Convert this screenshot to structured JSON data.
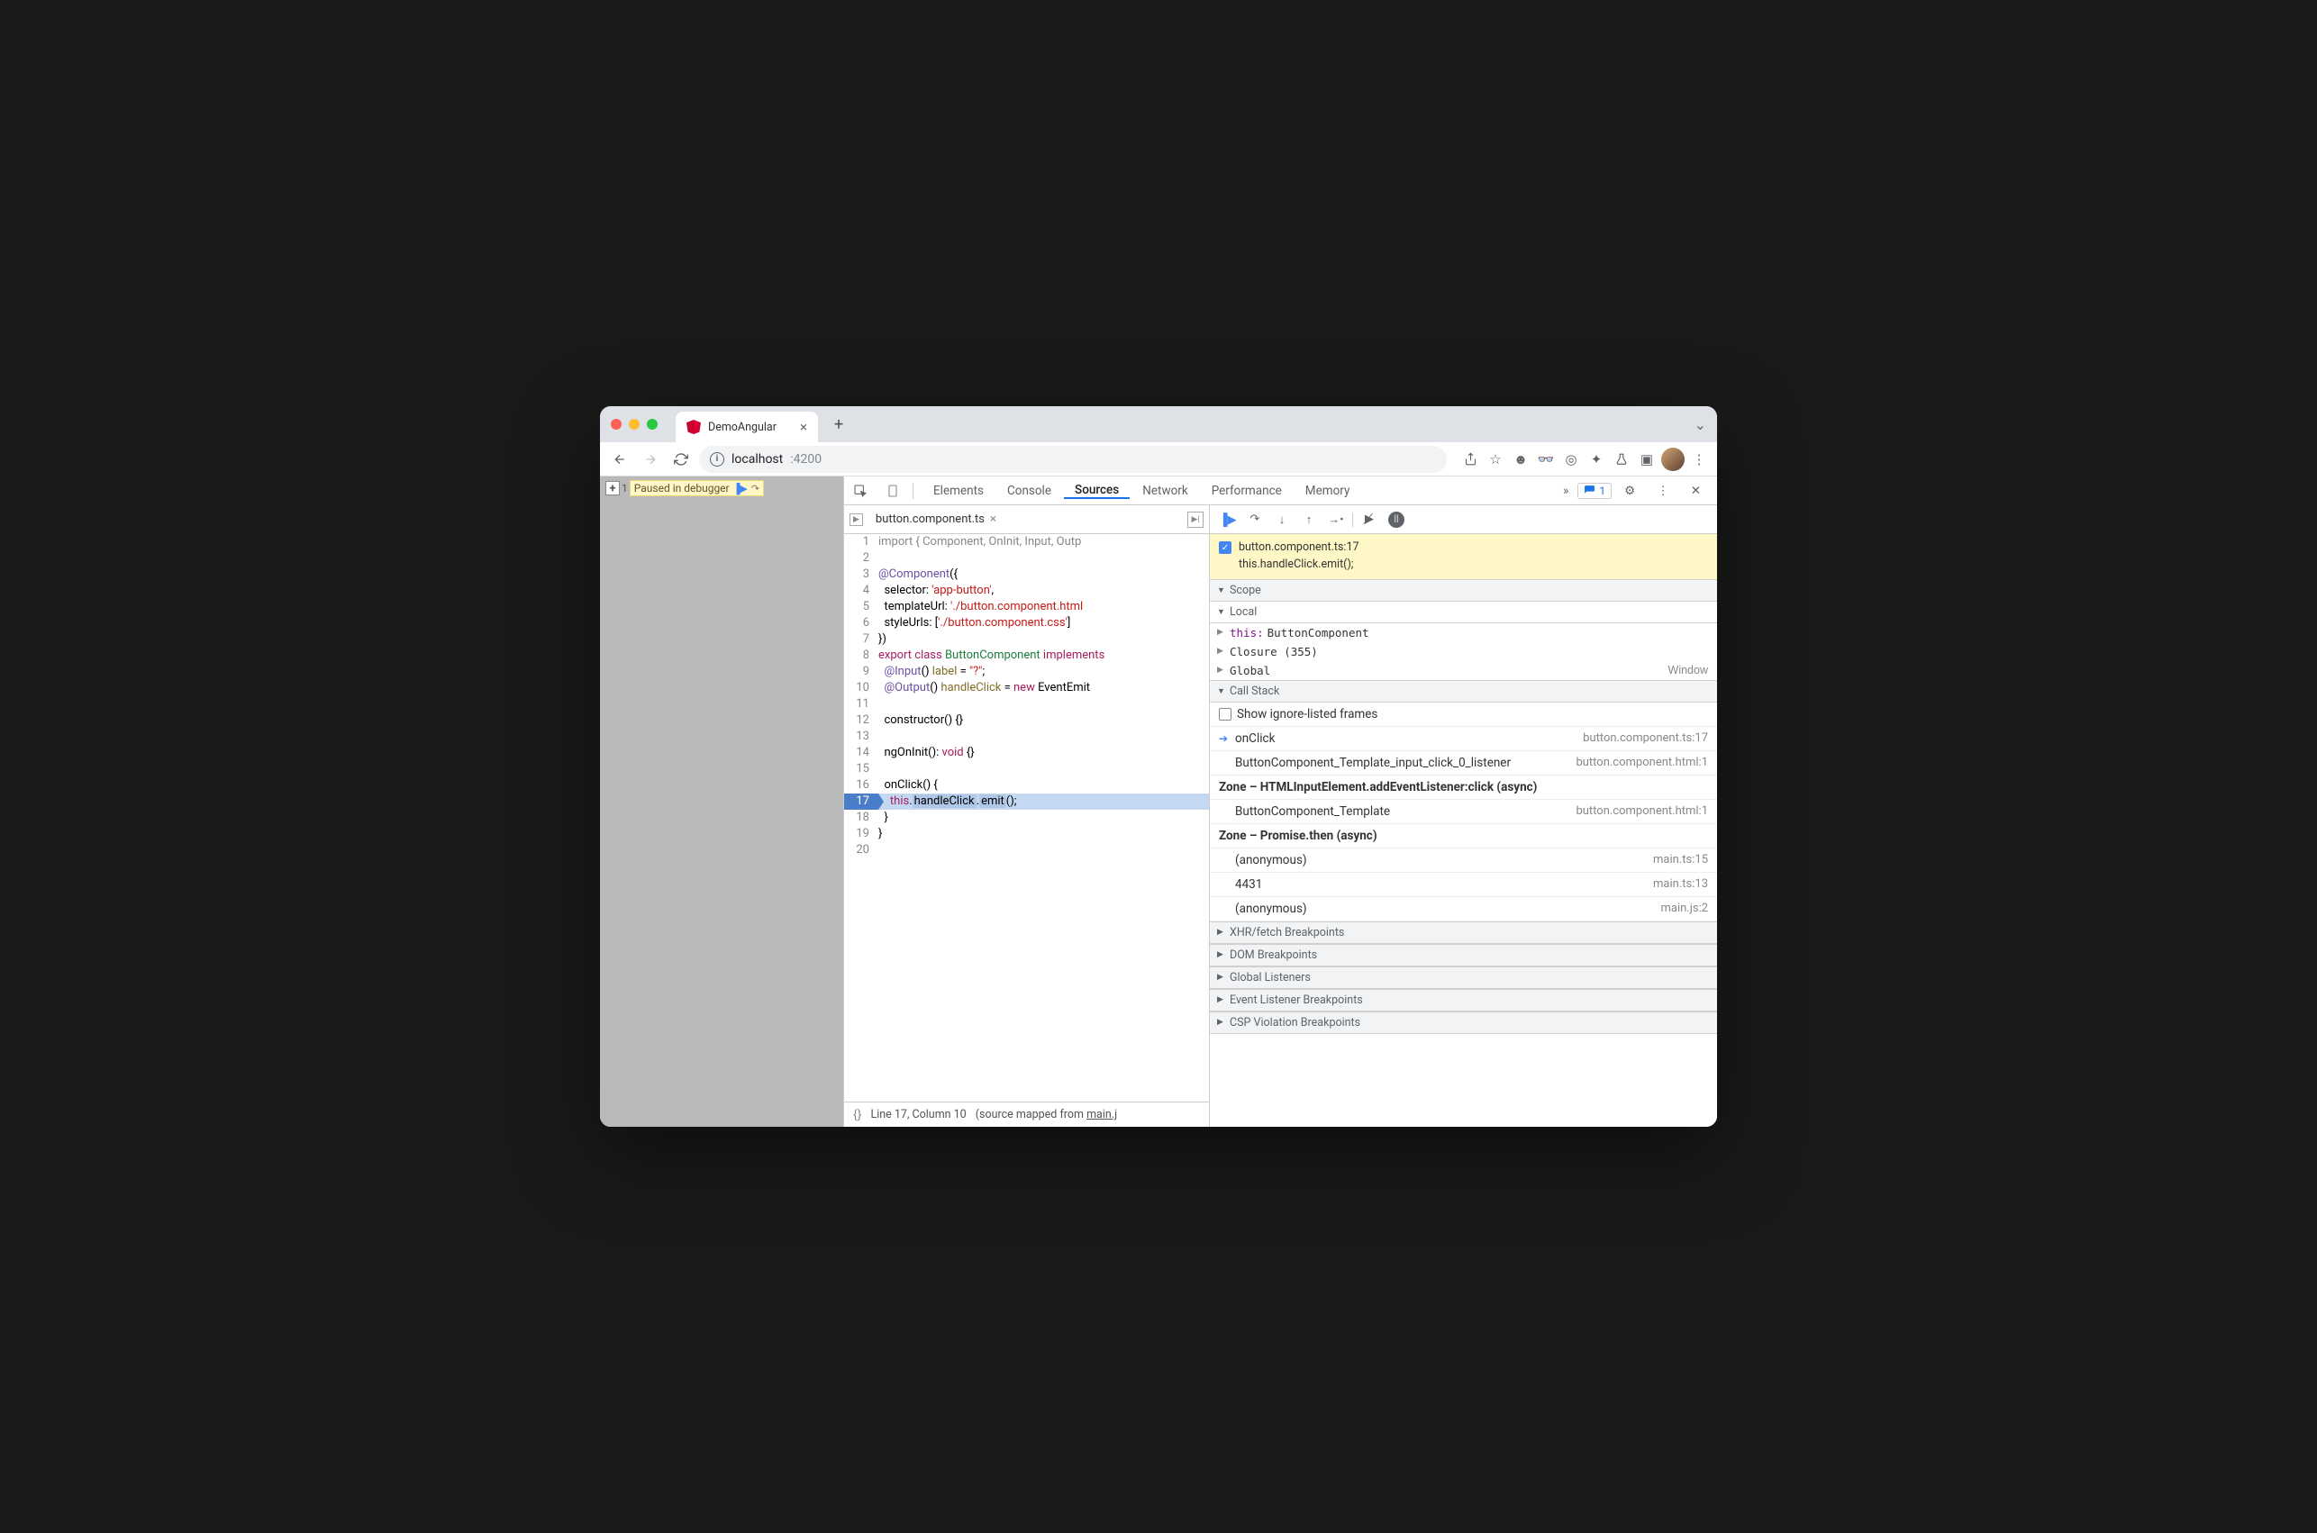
{
  "window": {
    "tab_title": "DemoAngular"
  },
  "address": {
    "url_host": "localhost",
    "url_port": ":4200"
  },
  "page": {
    "pause_label": "Paused in debugger",
    "pause_num": "1"
  },
  "devtools": {
    "tabs": [
      "Elements",
      "Console",
      "Sources",
      "Network",
      "Performance",
      "Memory"
    ],
    "active_tab": "Sources",
    "issues": "1",
    "file_tab": "button.component.ts",
    "status": {
      "line_col": "Line 17, Column 10",
      "mapped": "(source mapped from ",
      "mapped_link": "main.j"
    },
    "code": {
      "lines": [
        {
          "n": 1,
          "t": [
            {
              "c": "#888",
              "s": "import { Component, OnInit, Input, Outp"
            }
          ]
        },
        {
          "n": 2,
          "t": []
        },
        {
          "n": 3,
          "t": [
            {
              "c": "#6d4ea5",
              "s": "@Component"
            },
            {
              "s": "({"
            }
          ]
        },
        {
          "n": 4,
          "t": [
            {
              "s": "  selector: "
            },
            {
              "c": "#c41a16",
              "s": "'app-button'"
            },
            {
              "s": ","
            }
          ]
        },
        {
          "n": 5,
          "t": [
            {
              "s": "  templateUrl: "
            },
            {
              "c": "#c41a16",
              "s": "'./button.component.html"
            }
          ]
        },
        {
          "n": 6,
          "t": [
            {
              "s": "  styleUrls: ["
            },
            {
              "c": "#c41a16",
              "s": "'./button.component.css'"
            },
            {
              "s": "]"
            }
          ]
        },
        {
          "n": 7,
          "t": [
            {
              "s": "})"
            }
          ]
        },
        {
          "n": 8,
          "t": [
            {
              "c": "#a71d5d",
              "s": "export "
            },
            {
              "c": "#a71d5d",
              "s": "class "
            },
            {
              "c": "#1c7d3e",
              "s": "ButtonComponent "
            },
            {
              "c": "#a71d5d",
              "s": "implements"
            }
          ]
        },
        {
          "n": 9,
          "t": [
            {
              "s": "  "
            },
            {
              "c": "#6d4ea5",
              "s": "@Input"
            },
            {
              "s": "() "
            },
            {
              "c": "#836c28",
              "s": "label"
            },
            {
              "s": " = "
            },
            {
              "c": "#c41a16",
              "s": "\"?\""
            },
            {
              "s": ";"
            }
          ]
        },
        {
          "n": 10,
          "t": [
            {
              "s": "  "
            },
            {
              "c": "#6d4ea5",
              "s": "@Output"
            },
            {
              "s": "() "
            },
            {
              "c": "#836c28",
              "s": "handleClick"
            },
            {
              "s": " = "
            },
            {
              "c": "#a71d5d",
              "s": "new"
            },
            {
              "s": " EventEmit"
            }
          ]
        },
        {
          "n": 11,
          "t": []
        },
        {
          "n": 12,
          "t": [
            {
              "s": "  constructor() {}"
            }
          ]
        },
        {
          "n": 13,
          "t": []
        },
        {
          "n": 14,
          "t": [
            {
              "s": "  ngOnInit(): "
            },
            {
              "c": "#a71d5d",
              "s": "void"
            },
            {
              "s": " {}"
            }
          ]
        },
        {
          "n": 15,
          "t": []
        },
        {
          "n": 16,
          "t": [
            {
              "s": "  onClick() {"
            }
          ]
        },
        {
          "n": 17,
          "hl": true,
          "t": [
            {
              "s": "    "
            },
            {
              "c": "#a71d5d",
              "s": "this"
            },
            {
              "s": "."
            },
            {
              "bk": true,
              "s": "handleClick"
            },
            {
              "s": "."
            },
            {
              "bk": true,
              "s": "emit"
            },
            {
              "s": "();"
            }
          ]
        },
        {
          "n": 18,
          "t": [
            {
              "s": "  }"
            }
          ]
        },
        {
          "n": 19,
          "t": [
            {
              "s": "}"
            }
          ]
        },
        {
          "n": 20,
          "t": []
        }
      ]
    },
    "breakpoint": {
      "file": "button.component.ts:17",
      "code": "this.handleClick.emit();"
    },
    "scope": {
      "title": "Scope",
      "local": "Local",
      "this_lbl": "this:",
      "this_val": "ButtonComponent",
      "closure": "Closure (355)",
      "global": "Global",
      "global_val": "Window"
    },
    "callstack": {
      "title": "Call Stack",
      "show_ignored": "Show ignore-listed frames",
      "frames": [
        {
          "name": "onClick",
          "loc": "button.component.ts:17",
          "current": true
        },
        {
          "name": "ButtonComponent_Template_input_click_0_listener",
          "loc": "button.component.html:1"
        },
        {
          "name": "Zone – HTMLInputElement.addEventListener:click (async)",
          "async": true
        },
        {
          "name": "ButtonComponent_Template",
          "loc": "button.component.html:1"
        },
        {
          "name": "Zone – Promise.then (async)",
          "async": true
        },
        {
          "name": "(anonymous)",
          "loc": "main.ts:15"
        },
        {
          "name": "4431",
          "loc": "main.ts:13"
        },
        {
          "name": "(anonymous)",
          "loc": "main.js:2"
        }
      ]
    },
    "panels": [
      "XHR/fetch Breakpoints",
      "DOM Breakpoints",
      "Global Listeners",
      "Event Listener Breakpoints",
      "CSP Violation Breakpoints"
    ]
  }
}
